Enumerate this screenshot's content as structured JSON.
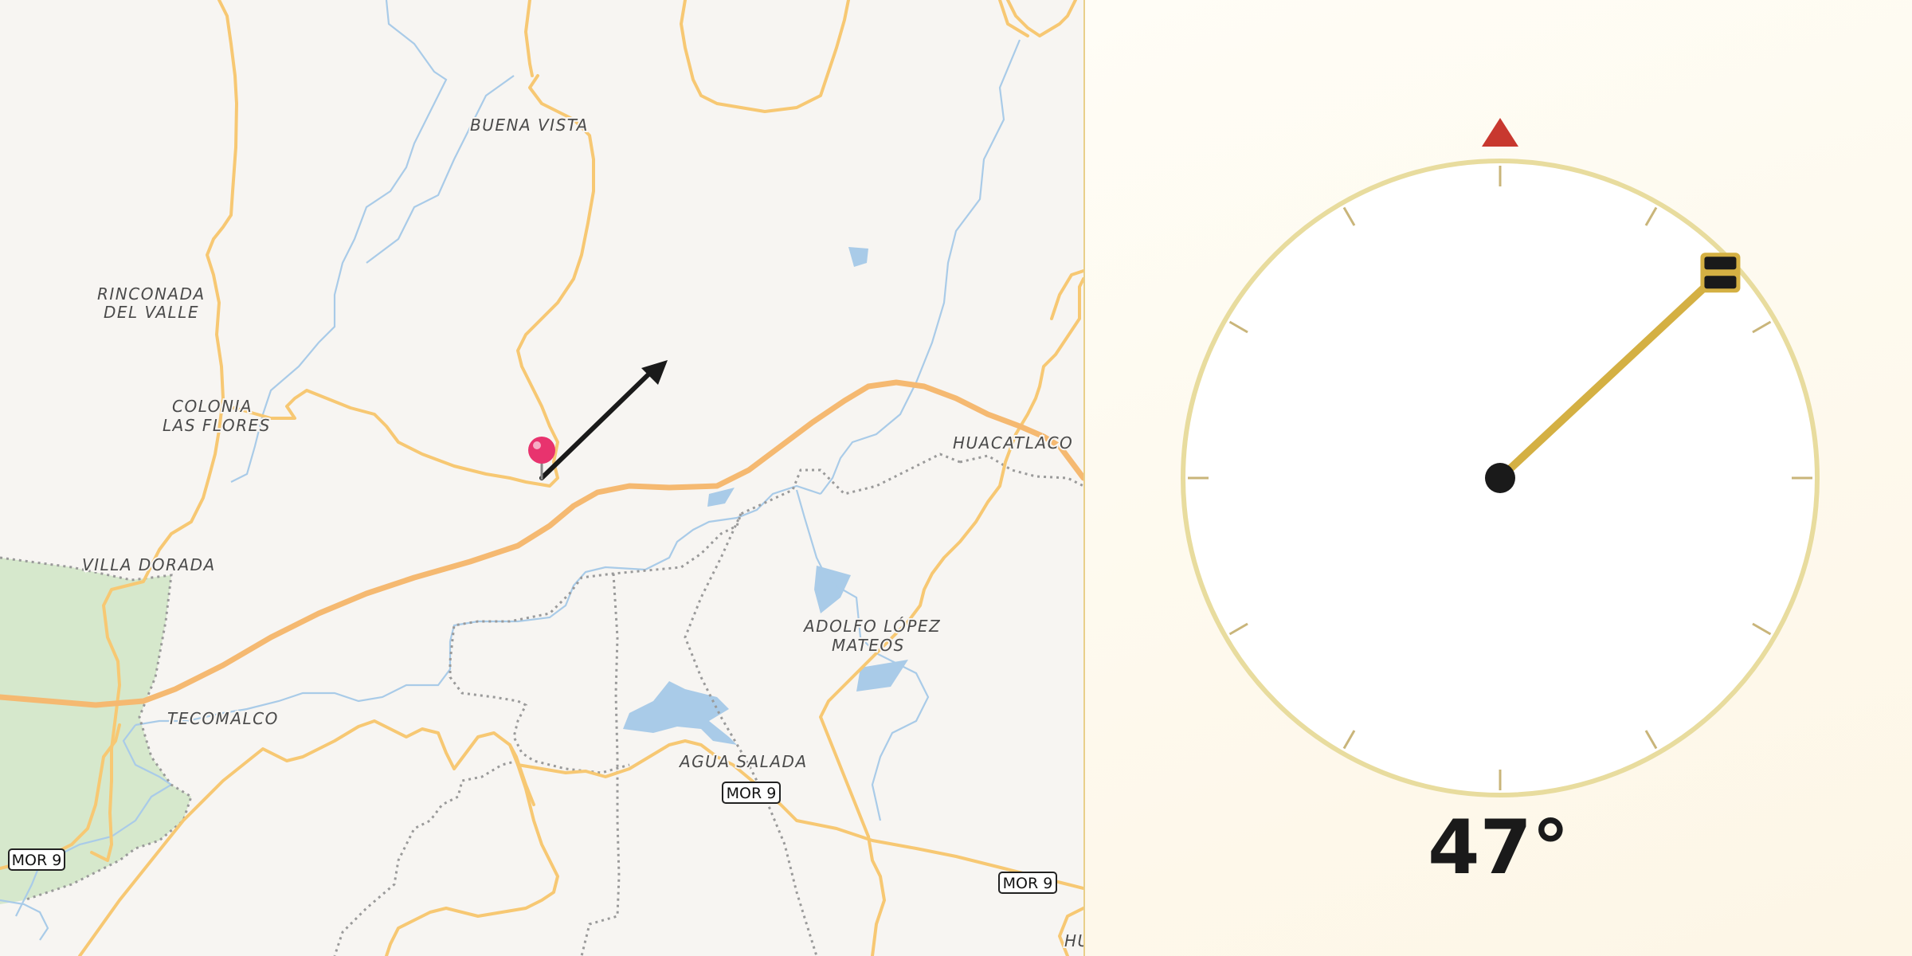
{
  "map": {
    "places": {
      "buena_vista": "BUENA VISTA",
      "rinconada_1": "RINCONADA",
      "rinconada_2": "DEL VALLE",
      "colonia_1": "COLONIA",
      "colonia_2": "LAS FLORES",
      "villa_dorada": "VILLA DORADA",
      "tecomalco": "TECOMALCO",
      "huacatlaco": "HUACATLACO",
      "adolfo_1": "ADOLFO LÓPEZ",
      "adolfo_2": "MATEOS",
      "agua_salada": "AGUA SALADA",
      "hu_partial": "HU"
    },
    "road_shields": {
      "west": "MOR 9",
      "center": "MOR 9",
      "east": "MOR 9"
    },
    "colors": {
      "background": "#f7f5f2",
      "road": "#f7c873",
      "highway": "#f5b971",
      "water": "#a9cbe8",
      "park": "#d6e8cc",
      "boundary": "#9a9a9a",
      "marker": "#e8336e"
    }
  },
  "compass": {
    "heading_deg": 47,
    "heading_label": "47°",
    "north_marker": "north-triangle-icon",
    "colors": {
      "ring": "#e8dc9e",
      "needle": "#d4b043",
      "north": "#c8382f",
      "center": "#1a1a1a"
    }
  }
}
